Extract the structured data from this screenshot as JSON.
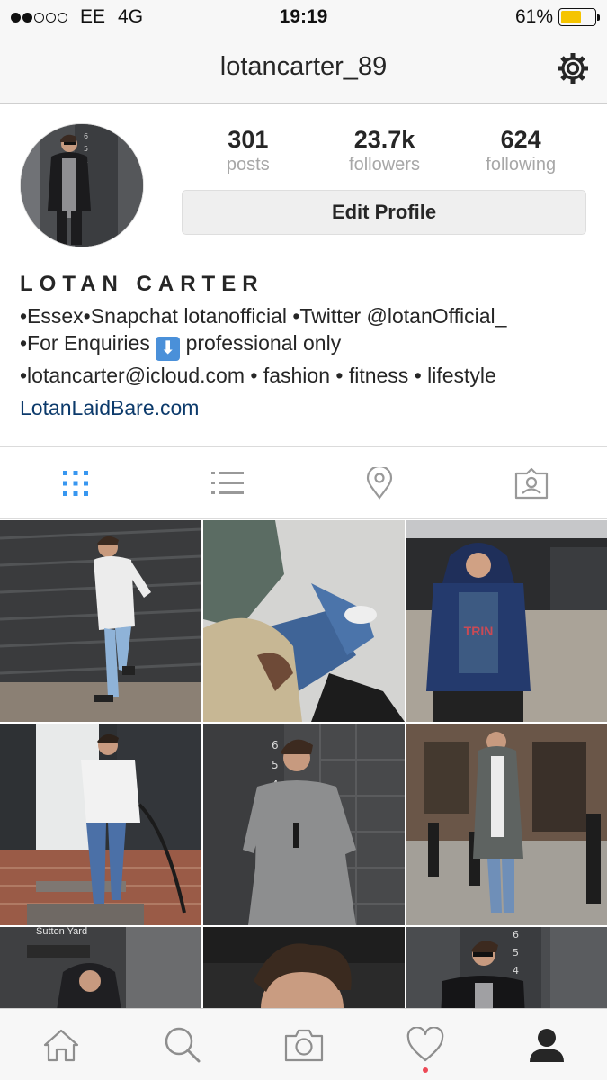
{
  "status_bar": {
    "carrier": "EE",
    "network": "4G",
    "time": "19:19",
    "battery_text": "61%",
    "battery_level": 0.61,
    "battery_color": "#f5c400"
  },
  "header": {
    "username": "lotancarter_89",
    "settings_icon": "gear-icon"
  },
  "profile": {
    "stats": [
      {
        "value": "301",
        "label": "posts"
      },
      {
        "value": "23.7k",
        "label": "followers"
      },
      {
        "value": "624",
        "label": "following"
      }
    ],
    "edit_label": "Edit Profile",
    "display_name": "LOTAN CARTER",
    "bio_line1": "•Essex•Snapchat lotanofficial •Twitter @lotanOfficial_",
    "bio_line2_before": "•For Enquiries ",
    "bio_line2_emoji": "⬇",
    "bio_line2_after": " professional only",
    "bio_line3": "•lotancarter@icloud.com • fashion • fitness • lifestyle",
    "website": "LotanLaidBare.com"
  },
  "view_tabs": [
    {
      "icon": "grid-view-icon",
      "active": true
    },
    {
      "icon": "list-view-icon",
      "active": false
    },
    {
      "icon": "location-pin-icon",
      "active": false
    },
    {
      "icon": "tagged-photos-icon",
      "active": false
    }
  ],
  "grid_text": {
    "tile3_shirt": "TRIN",
    "tile6_sign": "Sutton Yard",
    "tile5_numbers": "6 5 4 3"
  },
  "bottom_nav": [
    {
      "icon": "home-icon"
    },
    {
      "icon": "search-icon"
    },
    {
      "icon": "camera-icon"
    },
    {
      "icon": "heart-icon",
      "notification": true
    },
    {
      "icon": "profile-icon",
      "active": true
    }
  ],
  "colors": {
    "accent_blue": "#3897f0",
    "link_blue": "#0c3a6b",
    "notification_red": "#ed4956"
  }
}
